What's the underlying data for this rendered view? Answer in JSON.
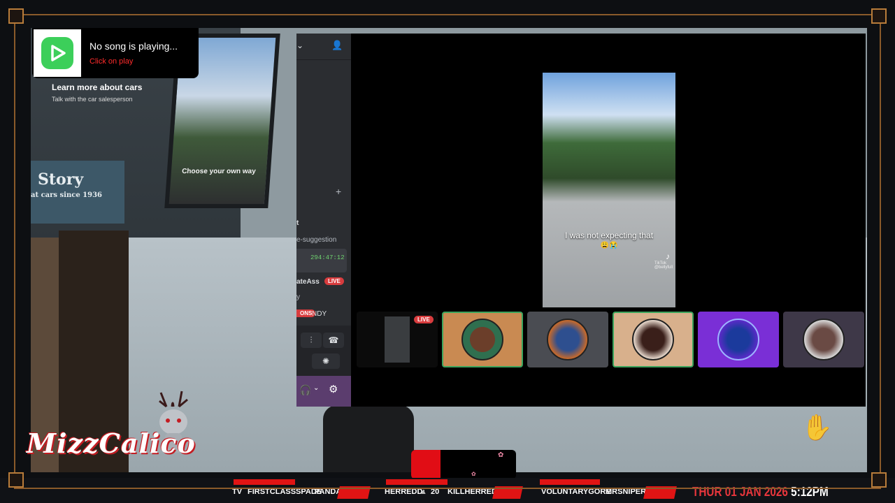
{
  "music_widget": {
    "title": "No song is playing...",
    "action": "Click on play"
  },
  "game": {
    "tooltip_title": "Learn more about cars",
    "tooltip_sub": "Talk with the car salesperson",
    "window_sign": "Choose your own way",
    "store_title": "Story",
    "store_sub": "at cars since 1936"
  },
  "discord": {
    "channel_suggestion": "e-suggestion",
    "timer": "294:47:12",
    "live_user": "ateAss",
    "live_badge": "LIVE",
    "misc_badge": "ONS",
    "misc_user": "NDY"
  },
  "video": {
    "caption": "I was not expecting that",
    "emoji": "😩😭",
    "watermark_name": "TikTok",
    "watermark_user": "@bellyfull"
  },
  "tiles": {
    "live_badge": "LIVE"
  },
  "overlay": {
    "logo_text": "MizzCalico"
  },
  "ticker": {
    "items": [
      "TV",
      "FIRSTCLASSSPADE",
      "PANDAP",
      "HERREDD:",
      "20",
      "KILLHERREDD:",
      "VOLUNTARYGORE",
      "MRSNIPER6"
    ],
    "date": "THUR 01 JAN 2026",
    "time": "5:12PM"
  }
}
